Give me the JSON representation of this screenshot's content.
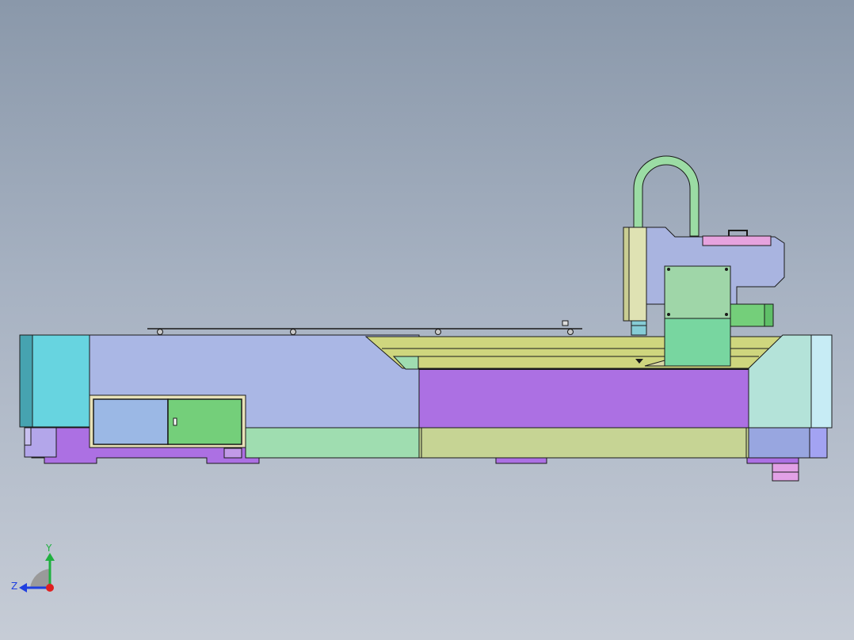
{
  "viewport": {
    "background_top": "#8a98aa",
    "background_bottom": "#c6ccd6"
  },
  "model": {
    "name": "laser-cutting-machine-side-view",
    "colors": {
      "outline": "#1a1a1a",
      "end_cap_left": "#67d4e0",
      "end_cap_right": "#b4e3d9",
      "bed_panel": "#aab7e5",
      "deck_yellow": "#cfd67e",
      "frame_purple": "#ac70e3",
      "cabinet_blue": "#9bb8e5",
      "cabinet_green": "#74cf7a",
      "rail_green": "#9fddb0",
      "rail_olive": "#c6d494",
      "spindle_head": "#a9b4e0",
      "spindle_column": "#dfe2b3",
      "spindle_motor": "#7fd19e",
      "cable_loop": "#9bdca4",
      "nameplate": "#e6a3de",
      "foot_pink": "#e2a1e6"
    }
  },
  "triad": {
    "x_color": "#e02020",
    "y_color": "#20b040",
    "z_color": "#2040e0",
    "y_label": "Y",
    "z_label": "Z"
  }
}
